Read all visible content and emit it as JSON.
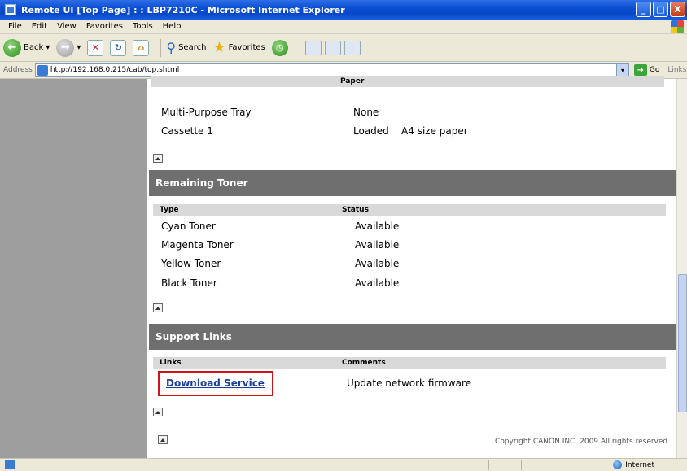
{
  "window": {
    "title": "Remote UI [Top Page] : : LBP7210C - Microsoft Internet Explorer",
    "buttons": [
      "_",
      "□",
      "X"
    ]
  },
  "menu": [
    "File",
    "Edit",
    "View",
    "Favorites",
    "Tools",
    "Help"
  ],
  "toolbar": {
    "back_label": "Back",
    "search_label": "Search",
    "favorites_label": "Favorites"
  },
  "address": {
    "label": "Address",
    "url": "http://192.168.0.215/cab/top.shtml",
    "go_label": "Go",
    "links_label": "Links"
  },
  "paper": {
    "status_header": "Paper",
    "rows": [
      {
        "type": "Multi-Purpose Tray",
        "status": "None"
      },
      {
        "type": "Cassette 1",
        "status": "Loaded    A4 size paper"
      }
    ]
  },
  "toner": {
    "title": "Remaining Toner",
    "headers": {
      "type": "Type",
      "status": "Status"
    },
    "rows": [
      {
        "type": "Cyan Toner",
        "status": "Available"
      },
      {
        "type": "Magenta Toner",
        "status": "Available"
      },
      {
        "type": "Yellow Toner",
        "status": "Available"
      },
      {
        "type": "Black Toner",
        "status": "Available"
      }
    ]
  },
  "support": {
    "title": "Support Links",
    "headers": {
      "links": "Links",
      "comments": "Comments"
    },
    "rows": [
      {
        "link": "Download Service",
        "comment": "Update network firmware"
      }
    ]
  },
  "footer": {
    "copyright": "Copyright CANON INC. 2009 All rights reserved."
  },
  "status": {
    "zone": "Internet"
  }
}
